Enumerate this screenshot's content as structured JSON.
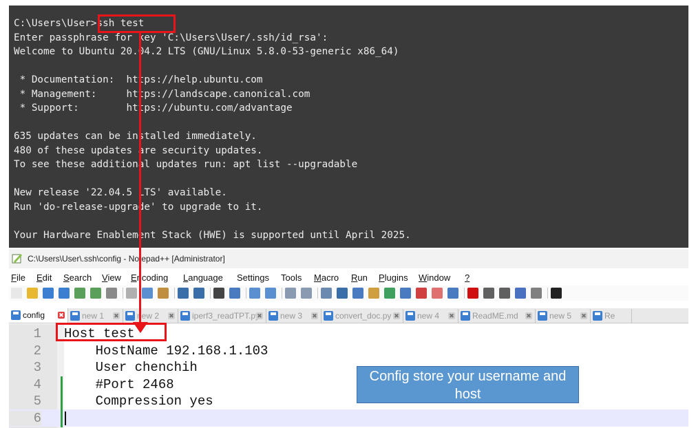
{
  "terminal": {
    "lines": [
      "C:\\Users\\User>ssh test",
      "Enter passphrase for key 'C:\\Users\\User/.ssh/id_rsa':",
      "Welcome to Ubuntu 20.04.2 LTS (GNU/Linux 5.8.0-53-generic x86_64)",
      "",
      " * Documentation:  https://help.ubuntu.com",
      " * Management:     https://landscape.canonical.com",
      " * Support:        https://ubuntu.com/advantage",
      "",
      "635 updates can be installed immediately.",
      "480 of these updates are security updates.",
      "To see these additional updates run: apt list --upgradable",
      "",
      "New release '22.04.5 LTS' available.",
      "Run 'do-release-upgrade' to upgrade to it.",
      "",
      "Your Hardware Enablement Stack (HWE) is supported until April 2025."
    ]
  },
  "window": {
    "title": "C:\\Users\\User\\.ssh\\config - Notepad++ [Administrator]"
  },
  "menu": [
    {
      "key": "F",
      "rest": "ile"
    },
    {
      "key": "E",
      "rest": "dit"
    },
    {
      "key": "S",
      "rest": "earch"
    },
    {
      "key": "V",
      "rest": "iew"
    },
    {
      "key": "E",
      "rest": "ncoding"
    },
    {
      "key": "L",
      "rest": "anguage"
    },
    {
      "key": "",
      "rest": "Settings"
    },
    {
      "key": "",
      "rest": "Tools"
    },
    {
      "key": "M",
      "rest": "acro"
    },
    {
      "key": "R",
      "rest": "un"
    },
    {
      "key": "P",
      "rest": "lugins"
    },
    {
      "key": "W",
      "rest": "indow"
    },
    {
      "key": "?",
      "rest": ""
    }
  ],
  "tabs": [
    {
      "label": "config",
      "active": true
    },
    {
      "label": "new 1",
      "active": false
    },
    {
      "label": "new 2",
      "active": false
    },
    {
      "label": "iperf3_readTPT.py",
      "active": false
    },
    {
      "label": "new 3",
      "active": false
    },
    {
      "label": "convert_doc.py",
      "active": false
    },
    {
      "label": "new 4",
      "active": false
    },
    {
      "label": "ReadME.md",
      "active": false
    },
    {
      "label": "new 5",
      "active": false
    },
    {
      "label": "Re",
      "active": false
    }
  ],
  "editor": {
    "lines": [
      {
        "num": "1",
        "text": "Host test"
      },
      {
        "num": "2",
        "text": "    HostName 192.168.1.103"
      },
      {
        "num": "3",
        "text": "    User chenchih"
      },
      {
        "num": "4",
        "text": "    #Port 2468"
      },
      {
        "num": "5",
        "text": "    Compression yes"
      },
      {
        "num": "6",
        "text": ""
      }
    ]
  },
  "callout": {
    "text": "Config store your username and host"
  },
  "colors": {
    "annotation_red": "#e8141a",
    "callout_blue": "#5a96d0",
    "terminal_bg": "#3a3a3a"
  }
}
